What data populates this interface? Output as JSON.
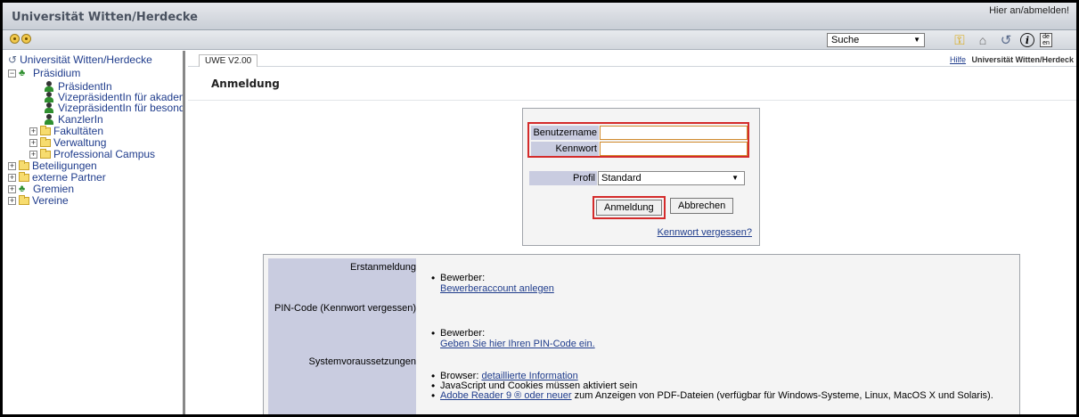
{
  "titlebar": {
    "brand": "Universität Witten/Herdecke",
    "login_link": "Hier an/abmelden!"
  },
  "toolbar": {
    "search_label": "Suche",
    "icons": [
      "key-icon",
      "home-icon",
      "refresh-icon",
      "info-icon",
      "language-icon"
    ],
    "lang_top": "de",
    "lang_bottom": "en"
  },
  "tree": {
    "root": "Universität Witten/Herdecke",
    "praesidium": "Präsidium",
    "praesidentin": "PräsidentIn",
    "vize1": "VizepräsidentIn für akadem",
    "vize2": "VizepräsidentIn für besonde",
    "kanzlerin": "KanzlerIn",
    "fakultaeten": "Fakultäten",
    "verwaltung": "Verwaltung",
    "professional": "Professional Campus",
    "beteiligungen": "Beteiligungen",
    "externe": "externe Partner",
    "gremien": "Gremien",
    "vereine": "Vereine"
  },
  "main": {
    "tab": "UWE V2.00",
    "help": "Hilfe",
    "org": "Universität Witten/Herdeck",
    "page_title": "Anmeldung"
  },
  "login": {
    "username_label": "Benutzername",
    "username_value": "",
    "password_label": "Kennwort",
    "password_value": "",
    "profil_label": "Profil",
    "profil_value": "Standard",
    "login_button": "Anmeldung",
    "cancel_button": "Abbrechen",
    "forgot_link": "Kennwort vergessen?"
  },
  "info": {
    "erstanmeldung": "Erstanmeldung",
    "bewerber1": "Bewerber:",
    "bewerber_link": "Bewerberaccount anlegen",
    "pin_label": "PIN-Code (Kennwort vergessen)",
    "bewerber2": "Bewerber:",
    "pin_link": "Geben Sie hier Ihren PIN-Code ein.",
    "system_label": "Systemvoraussetzungen",
    "browser_text": "Browser:",
    "browser_link": "detaillierte Information",
    "js_text": "JavaScript und Cookies müssen aktiviert sein",
    "adobe_link": "Adobe Reader 9 ® oder neuer",
    "adobe_text": "zum Anzeigen von PDF-Dateien (verfügbar für Windows-Systeme, Linux, MacOS X und Solaris)."
  }
}
